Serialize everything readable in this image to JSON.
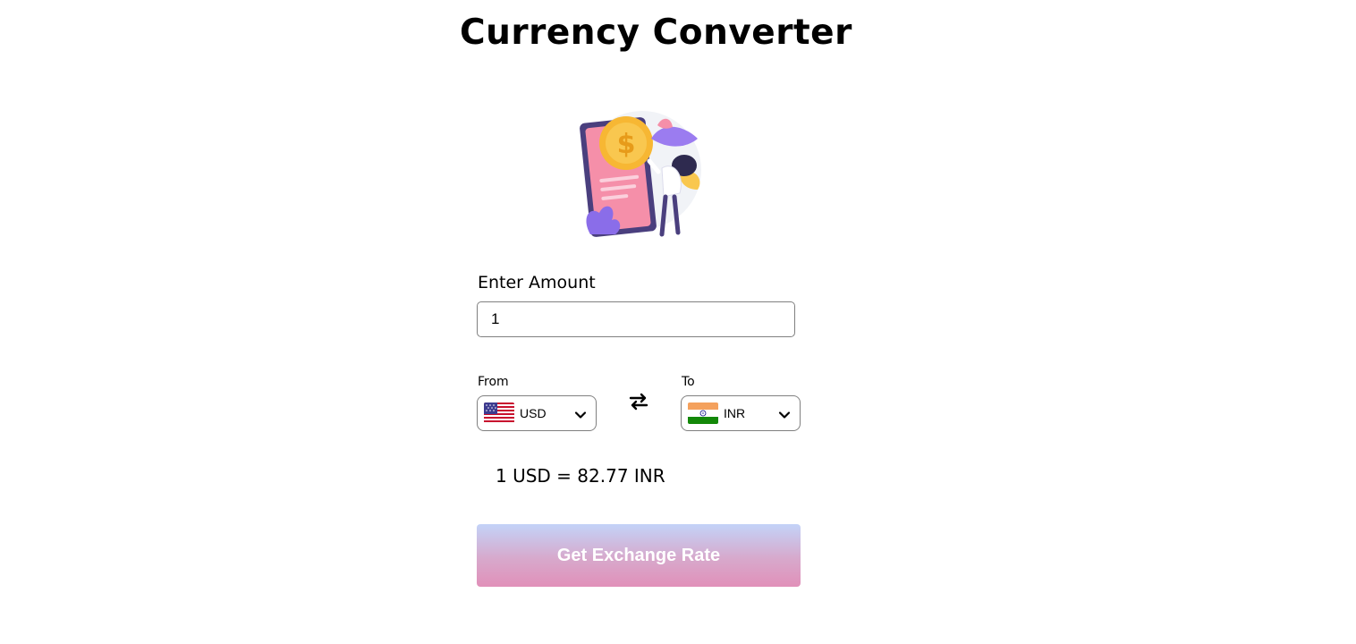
{
  "header": {
    "title": "Currency Converter"
  },
  "illustration": {
    "icon": "money-illustration"
  },
  "amount": {
    "label": "Enter Amount",
    "value": "1",
    "placeholder": ""
  },
  "from": {
    "label": "From",
    "currency": "USD",
    "flag": "us-flag-icon"
  },
  "to": {
    "label": "To",
    "currency": "INR",
    "flag": "india-flag-icon"
  },
  "swap": {
    "icon": "swap-arrows-icon"
  },
  "result": {
    "text": "1 USD = 82.77 INR"
  },
  "button": {
    "label": "Get Exchange Rate"
  },
  "colors": {
    "button_gradient_top": "#c3d3f8",
    "button_gradient_bottom": "#e190b9",
    "border": "#808080"
  }
}
